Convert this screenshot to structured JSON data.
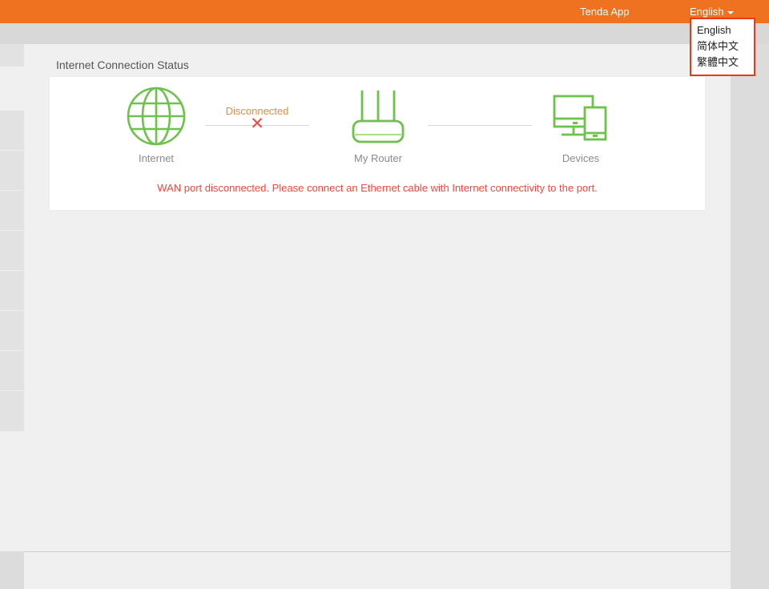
{
  "topbar": {
    "tenda_app_label": "Tenda App",
    "language_label": "English",
    "accent_color": "#ef7221"
  },
  "language_dropdown": {
    "border_color": "#e8391b",
    "options": [
      {
        "label": "English"
      },
      {
        "label": "简体中文"
      },
      {
        "label": "繁體中文"
      }
    ]
  },
  "sidebar": {
    "items": [
      {
        "label": ""
      },
      {
        "label": ""
      },
      {
        "label": ""
      },
      {
        "label": ""
      },
      {
        "label": ""
      },
      {
        "label": ""
      },
      {
        "label": ""
      },
      {
        "label": ""
      }
    ]
  },
  "main": {
    "panel_title": "Internet Connection Status",
    "nodes": [
      {
        "name": "internet-node",
        "icon": "globe-icon",
        "label": "Internet",
        "color": "#6cc24a"
      },
      {
        "name": "router-node",
        "icon": "router-icon",
        "label": "My Router",
        "color": "#6cc24a"
      },
      {
        "name": "devices-node",
        "icon": "devices-icon",
        "label": "Devices",
        "color": "#6cc24a"
      }
    ],
    "links": [
      {
        "name": "internet-router-link",
        "status": "Disconnected",
        "marker": "✕",
        "status_color": "#ef8b3c",
        "marker_color": "#f0483e"
      },
      {
        "name": "router-devices-link",
        "status": "",
        "marker": "",
        "status_color": "",
        "marker_color": ""
      }
    ],
    "error_message": "WAN port disconnected. Please connect an Ethernet cable with Internet connectivity to the port.",
    "error_color": "#f5463c"
  }
}
